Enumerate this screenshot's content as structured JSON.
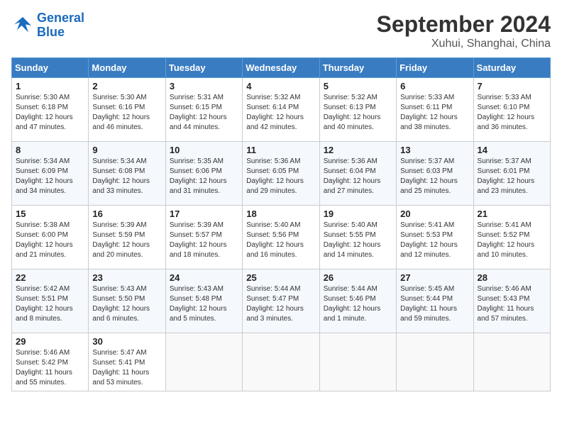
{
  "header": {
    "logo_line1": "General",
    "logo_line2": "Blue",
    "month": "September 2024",
    "location": "Xuhui, Shanghai, China"
  },
  "days_of_week": [
    "Sunday",
    "Monday",
    "Tuesday",
    "Wednesday",
    "Thursday",
    "Friday",
    "Saturday"
  ],
  "weeks": [
    [
      {
        "day": "1",
        "info": "Sunrise: 5:30 AM\nSunset: 6:18 PM\nDaylight: 12 hours\nand 47 minutes."
      },
      {
        "day": "2",
        "info": "Sunrise: 5:30 AM\nSunset: 6:16 PM\nDaylight: 12 hours\nand 46 minutes."
      },
      {
        "day": "3",
        "info": "Sunrise: 5:31 AM\nSunset: 6:15 PM\nDaylight: 12 hours\nand 44 minutes."
      },
      {
        "day": "4",
        "info": "Sunrise: 5:32 AM\nSunset: 6:14 PM\nDaylight: 12 hours\nand 42 minutes."
      },
      {
        "day": "5",
        "info": "Sunrise: 5:32 AM\nSunset: 6:13 PM\nDaylight: 12 hours\nand 40 minutes."
      },
      {
        "day": "6",
        "info": "Sunrise: 5:33 AM\nSunset: 6:11 PM\nDaylight: 12 hours\nand 38 minutes."
      },
      {
        "day": "7",
        "info": "Sunrise: 5:33 AM\nSunset: 6:10 PM\nDaylight: 12 hours\nand 36 minutes."
      }
    ],
    [
      {
        "day": "8",
        "info": "Sunrise: 5:34 AM\nSunset: 6:09 PM\nDaylight: 12 hours\nand 34 minutes."
      },
      {
        "day": "9",
        "info": "Sunrise: 5:34 AM\nSunset: 6:08 PM\nDaylight: 12 hours\nand 33 minutes."
      },
      {
        "day": "10",
        "info": "Sunrise: 5:35 AM\nSunset: 6:06 PM\nDaylight: 12 hours\nand 31 minutes."
      },
      {
        "day": "11",
        "info": "Sunrise: 5:36 AM\nSunset: 6:05 PM\nDaylight: 12 hours\nand 29 minutes."
      },
      {
        "day": "12",
        "info": "Sunrise: 5:36 AM\nSunset: 6:04 PM\nDaylight: 12 hours\nand 27 minutes."
      },
      {
        "day": "13",
        "info": "Sunrise: 5:37 AM\nSunset: 6:03 PM\nDaylight: 12 hours\nand 25 minutes."
      },
      {
        "day": "14",
        "info": "Sunrise: 5:37 AM\nSunset: 6:01 PM\nDaylight: 12 hours\nand 23 minutes."
      }
    ],
    [
      {
        "day": "15",
        "info": "Sunrise: 5:38 AM\nSunset: 6:00 PM\nDaylight: 12 hours\nand 21 minutes."
      },
      {
        "day": "16",
        "info": "Sunrise: 5:39 AM\nSunset: 5:59 PM\nDaylight: 12 hours\nand 20 minutes."
      },
      {
        "day": "17",
        "info": "Sunrise: 5:39 AM\nSunset: 5:57 PM\nDaylight: 12 hours\nand 18 minutes."
      },
      {
        "day": "18",
        "info": "Sunrise: 5:40 AM\nSunset: 5:56 PM\nDaylight: 12 hours\nand 16 minutes."
      },
      {
        "day": "19",
        "info": "Sunrise: 5:40 AM\nSunset: 5:55 PM\nDaylight: 12 hours\nand 14 minutes."
      },
      {
        "day": "20",
        "info": "Sunrise: 5:41 AM\nSunset: 5:53 PM\nDaylight: 12 hours\nand 12 minutes."
      },
      {
        "day": "21",
        "info": "Sunrise: 5:41 AM\nSunset: 5:52 PM\nDaylight: 12 hours\nand 10 minutes."
      }
    ],
    [
      {
        "day": "22",
        "info": "Sunrise: 5:42 AM\nSunset: 5:51 PM\nDaylight: 12 hours\nand 8 minutes."
      },
      {
        "day": "23",
        "info": "Sunrise: 5:43 AM\nSunset: 5:50 PM\nDaylight: 12 hours\nand 6 minutes."
      },
      {
        "day": "24",
        "info": "Sunrise: 5:43 AM\nSunset: 5:48 PM\nDaylight: 12 hours\nand 5 minutes."
      },
      {
        "day": "25",
        "info": "Sunrise: 5:44 AM\nSunset: 5:47 PM\nDaylight: 12 hours\nand 3 minutes."
      },
      {
        "day": "26",
        "info": "Sunrise: 5:44 AM\nSunset: 5:46 PM\nDaylight: 12 hours\nand 1 minute."
      },
      {
        "day": "27",
        "info": "Sunrise: 5:45 AM\nSunset: 5:44 PM\nDaylight: 11 hours\nand 59 minutes."
      },
      {
        "day": "28",
        "info": "Sunrise: 5:46 AM\nSunset: 5:43 PM\nDaylight: 11 hours\nand 57 minutes."
      }
    ],
    [
      {
        "day": "29",
        "info": "Sunrise: 5:46 AM\nSunset: 5:42 PM\nDaylight: 11 hours\nand 55 minutes."
      },
      {
        "day": "30",
        "info": "Sunrise: 5:47 AM\nSunset: 5:41 PM\nDaylight: 11 hours\nand 53 minutes."
      },
      {
        "day": "",
        "info": ""
      },
      {
        "day": "",
        "info": ""
      },
      {
        "day": "",
        "info": ""
      },
      {
        "day": "",
        "info": ""
      },
      {
        "day": "",
        "info": ""
      }
    ]
  ]
}
